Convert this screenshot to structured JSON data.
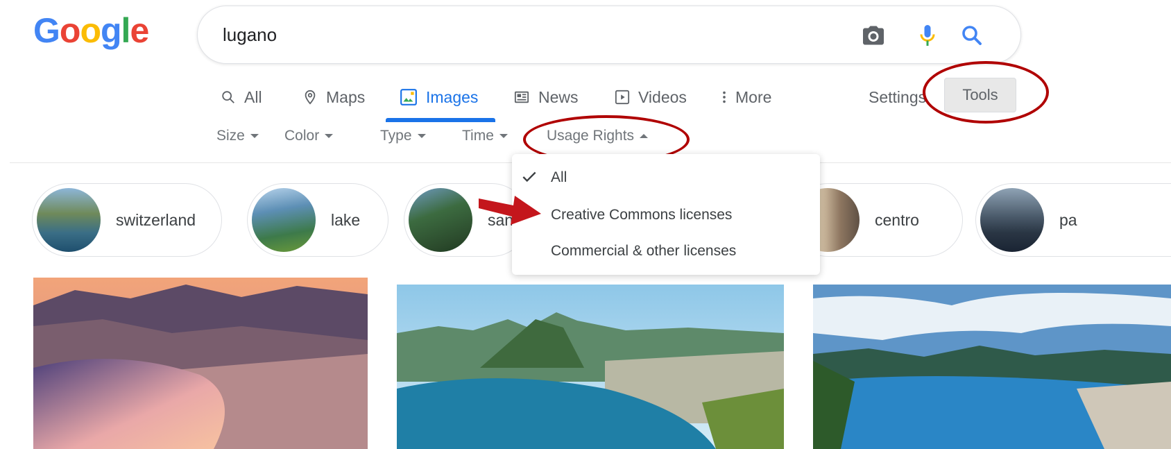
{
  "logo": {
    "letters": [
      "G",
      "o",
      "o",
      "g",
      "l",
      "e"
    ],
    "colors": [
      "#4285F4",
      "#EA4335",
      "#FBBC05",
      "#4285F4",
      "#34A853",
      "#EA4335"
    ]
  },
  "search": {
    "query": "lugano"
  },
  "icons": {
    "camera": "camera-icon",
    "mic": "microphone-icon",
    "search": "search-icon"
  },
  "tabs": [
    {
      "label": "All",
      "icon": "search-icon",
      "active": false
    },
    {
      "label": "Maps",
      "icon": "map-pin-icon",
      "active": false
    },
    {
      "label": "Images",
      "icon": "image-icon",
      "active": true
    },
    {
      "label": "News",
      "icon": "newspaper-icon",
      "active": false
    },
    {
      "label": "Videos",
      "icon": "play-icon",
      "active": false
    },
    {
      "label": "More",
      "icon": "vertical-dots-icon",
      "active": false
    }
  ],
  "settings_label": "Settings",
  "tools_label": "Tools",
  "filters": [
    {
      "label": "Size",
      "expanded": false
    },
    {
      "label": "Color",
      "expanded": false
    },
    {
      "label": "Type",
      "expanded": false
    },
    {
      "label": "Time",
      "expanded": false
    },
    {
      "label": "Usage Rights",
      "expanded": true
    }
  ],
  "chips": [
    {
      "label": "switzerland"
    },
    {
      "label": "lake"
    },
    {
      "label": "san"
    },
    {
      "label": "centro"
    },
    {
      "label": "pa"
    }
  ],
  "usage_menu": {
    "items": [
      {
        "label": "All",
        "checked": true
      },
      {
        "label": "Creative Commons licenses",
        "checked": false
      },
      {
        "label": "Commercial & other licenses",
        "checked": false
      }
    ]
  },
  "colors": {
    "accent": "#1a73e8",
    "annotation": "#b00000"
  }
}
